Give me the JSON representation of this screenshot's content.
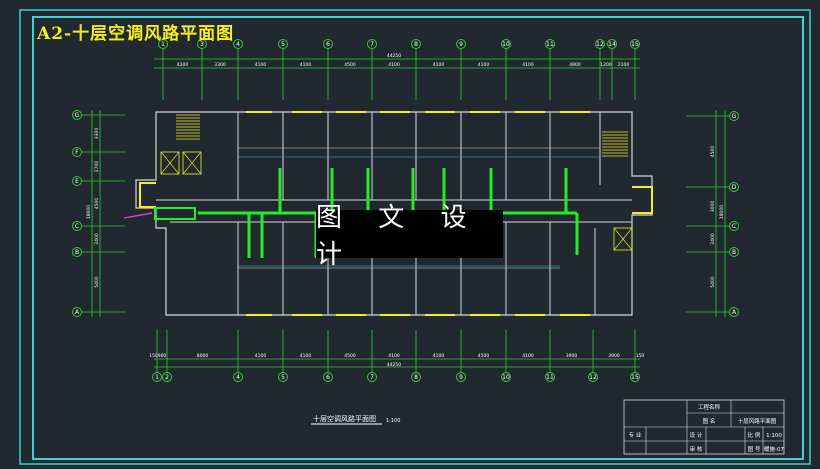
{
  "title": "A2-十层空调风路平面图",
  "watermark": "图 文 设 计",
  "drawing_caption": "十层空调风路平面图",
  "drawing_scale": "1:100",
  "axes": {
    "top": [
      "1",
      "3",
      "4",
      "5",
      "6",
      "7",
      "8",
      "9",
      "10",
      "11",
      "12",
      "14",
      "15"
    ],
    "bottom": [
      "1",
      "2",
      "4",
      "5",
      "6",
      "7",
      "8",
      "9",
      "10",
      "11",
      "12",
      "15"
    ],
    "left": [
      "G",
      "F",
      "E",
      "C",
      "B",
      "A"
    ],
    "right": [
      "G",
      "D",
      "C",
      "B",
      "A"
    ]
  },
  "dimensions": {
    "top_total": "44250",
    "top": [
      "4200",
      "3300",
      "4100",
      "4100",
      "4500",
      "4100",
      "4100",
      "4100",
      "4100",
      "4800",
      "1200",
      "2100"
    ],
    "bottom_total": "44250",
    "bottom": [
      "150",
      "900",
      "8000",
      "4100",
      "4100",
      "4500",
      "4100",
      "4100",
      "4500",
      "4100",
      "3900",
      "3900",
      "150"
    ],
    "left_total": "18000",
    "left": [
      "3300",
      "2700",
      "4500",
      "2400",
      "5400"
    ],
    "right_total": "18000",
    "right": [
      "4500",
      "3000",
      "2400",
      "5400"
    ]
  },
  "title_block": {
    "project_label": "工程名称",
    "drawing_name_label": "图 名",
    "drawing_name": "十层风路平面图",
    "specialty_label": "专 业",
    "design_label": "设 计",
    "review_label": "审 核",
    "scale_label": "比 例",
    "scale": "1:100",
    "number_label": "图 号",
    "number": "暖施-07"
  },
  "colors": {
    "background": "#212830",
    "axis": "#2ad12a",
    "wall": "#d8d8d8",
    "window": "#f4f01a",
    "duct": "#22ee22",
    "dim": "#1fc6cf",
    "frame": "#34d6d6"
  }
}
